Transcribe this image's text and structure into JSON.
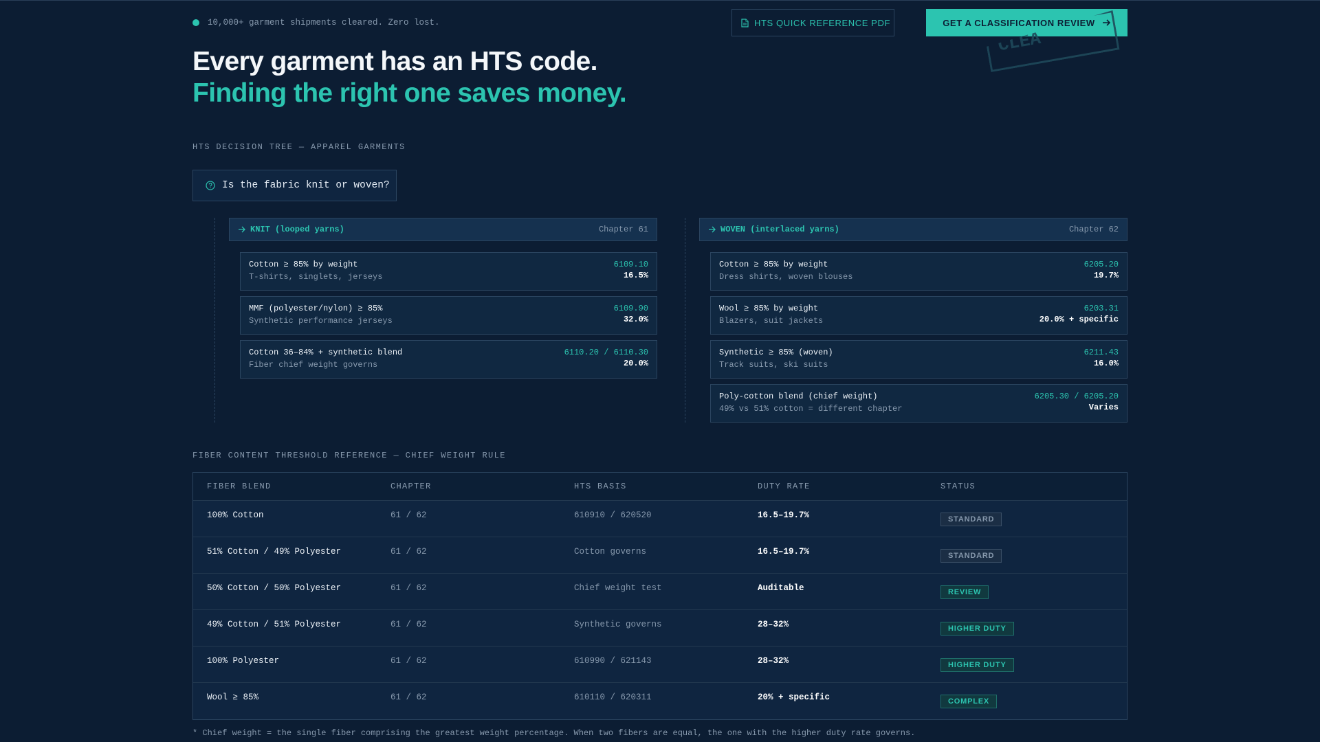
{
  "topbar": {
    "tagline": "10,000+ garment shipments cleared. Zero lost.",
    "pdf_button": "HTS QUICK REFERENCE PDF",
    "review_button": "GET A CLASSIFICATION REVIEW",
    "stamp_text": "CLEA"
  },
  "hero": {
    "line1": "Every garment has an HTS code.",
    "line2": "Finding the right one saves money."
  },
  "tree": {
    "label": "HTS DECISION TREE — APPAREL GARMENTS",
    "question": "Is the fabric knit or woven?",
    "knit": {
      "title": "KNIT (looped yarns)",
      "chapter": "Chapter 61",
      "leaves": [
        {
          "name": "Cotton ≥ 85% by weight",
          "desc": "T-shirts, singlets, jerseys",
          "code": "6109.10",
          "rate": "16.5%"
        },
        {
          "name": "MMF (polyester/nylon) ≥ 85%",
          "desc": "Synthetic performance jerseys",
          "code": "6109.90",
          "rate": "32.0%"
        },
        {
          "name": "Cotton 36–84% + synthetic blend",
          "desc": "Fiber chief weight governs",
          "code": "6110.20 / 6110.30",
          "rate": "20.0%"
        }
      ]
    },
    "woven": {
      "title": "WOVEN (interlaced yarns)",
      "chapter": "Chapter 62",
      "leaves": [
        {
          "name": "Cotton ≥ 85% by weight",
          "desc": "Dress shirts, woven blouses",
          "code": "6205.20",
          "rate": "19.7%"
        },
        {
          "name": "Wool ≥ 85% by weight",
          "desc": "Blazers, suit jackets",
          "code": "6203.31",
          "rate": "20.0% + specific"
        },
        {
          "name": "Synthetic ≥ 85% (woven)",
          "desc": "Track suits, ski suits",
          "code": "6211.43",
          "rate": "16.0%"
        },
        {
          "name": "Poly-cotton blend (chief weight)",
          "desc": "49% vs 51% cotton = different chapter",
          "code": "6205.30 / 6205.20",
          "rate": "Varies"
        }
      ]
    }
  },
  "table": {
    "label": "FIBER CONTENT THRESHOLD REFERENCE — CHIEF WEIGHT RULE",
    "headers": [
      "FIBER BLEND",
      "CHAPTER",
      "HTS BASIS",
      "DUTY RATE",
      "STATUS"
    ],
    "rows": [
      {
        "blend": "100% Cotton",
        "chapter": "61 / 62",
        "basis": "610910 / 620520",
        "duty": "16.5–19.7%",
        "status": "STANDARD"
      },
      {
        "blend": "51% Cotton / 49% Polyester",
        "chapter": "61 / 62",
        "basis": "Cotton governs",
        "duty": "16.5–19.7%",
        "status": "STANDARD"
      },
      {
        "blend": "50% Cotton / 50% Polyester",
        "chapter": "61 / 62",
        "basis": "Chief weight test",
        "duty": "Auditable",
        "status": "REVIEW"
      },
      {
        "blend": "49% Cotton / 51% Polyester",
        "chapter": "61 / 62",
        "basis": "Synthetic governs",
        "duty": "28–32%",
        "status": "HIGHER DUTY"
      },
      {
        "blend": "100% Polyester",
        "chapter": "61 / 62",
        "basis": "610990 / 621143",
        "duty": "28–32%",
        "status": "HIGHER DUTY"
      },
      {
        "blend": "Wool ≥ 85%",
        "chapter": "61 / 62",
        "basis": "610110 / 620311",
        "duty": "20% + specific",
        "status": "COMPLEX"
      }
    ],
    "footnote": "* Chief weight = the single fiber comprising the greatest weight percentage. When two fibers are equal, the one with the higher duty rate governs."
  },
  "colors": {
    "background": "#0c1d33",
    "accent": "#2cc4b0",
    "panel": "#102841",
    "border": "#2b4560",
    "muted": "#8799ad"
  },
  "icons": {
    "pdf": "document-icon",
    "review": "arrow-right-icon",
    "question": "help-circle-icon",
    "branch": "arrow-right-icon",
    "status": "status-dot-icon"
  }
}
